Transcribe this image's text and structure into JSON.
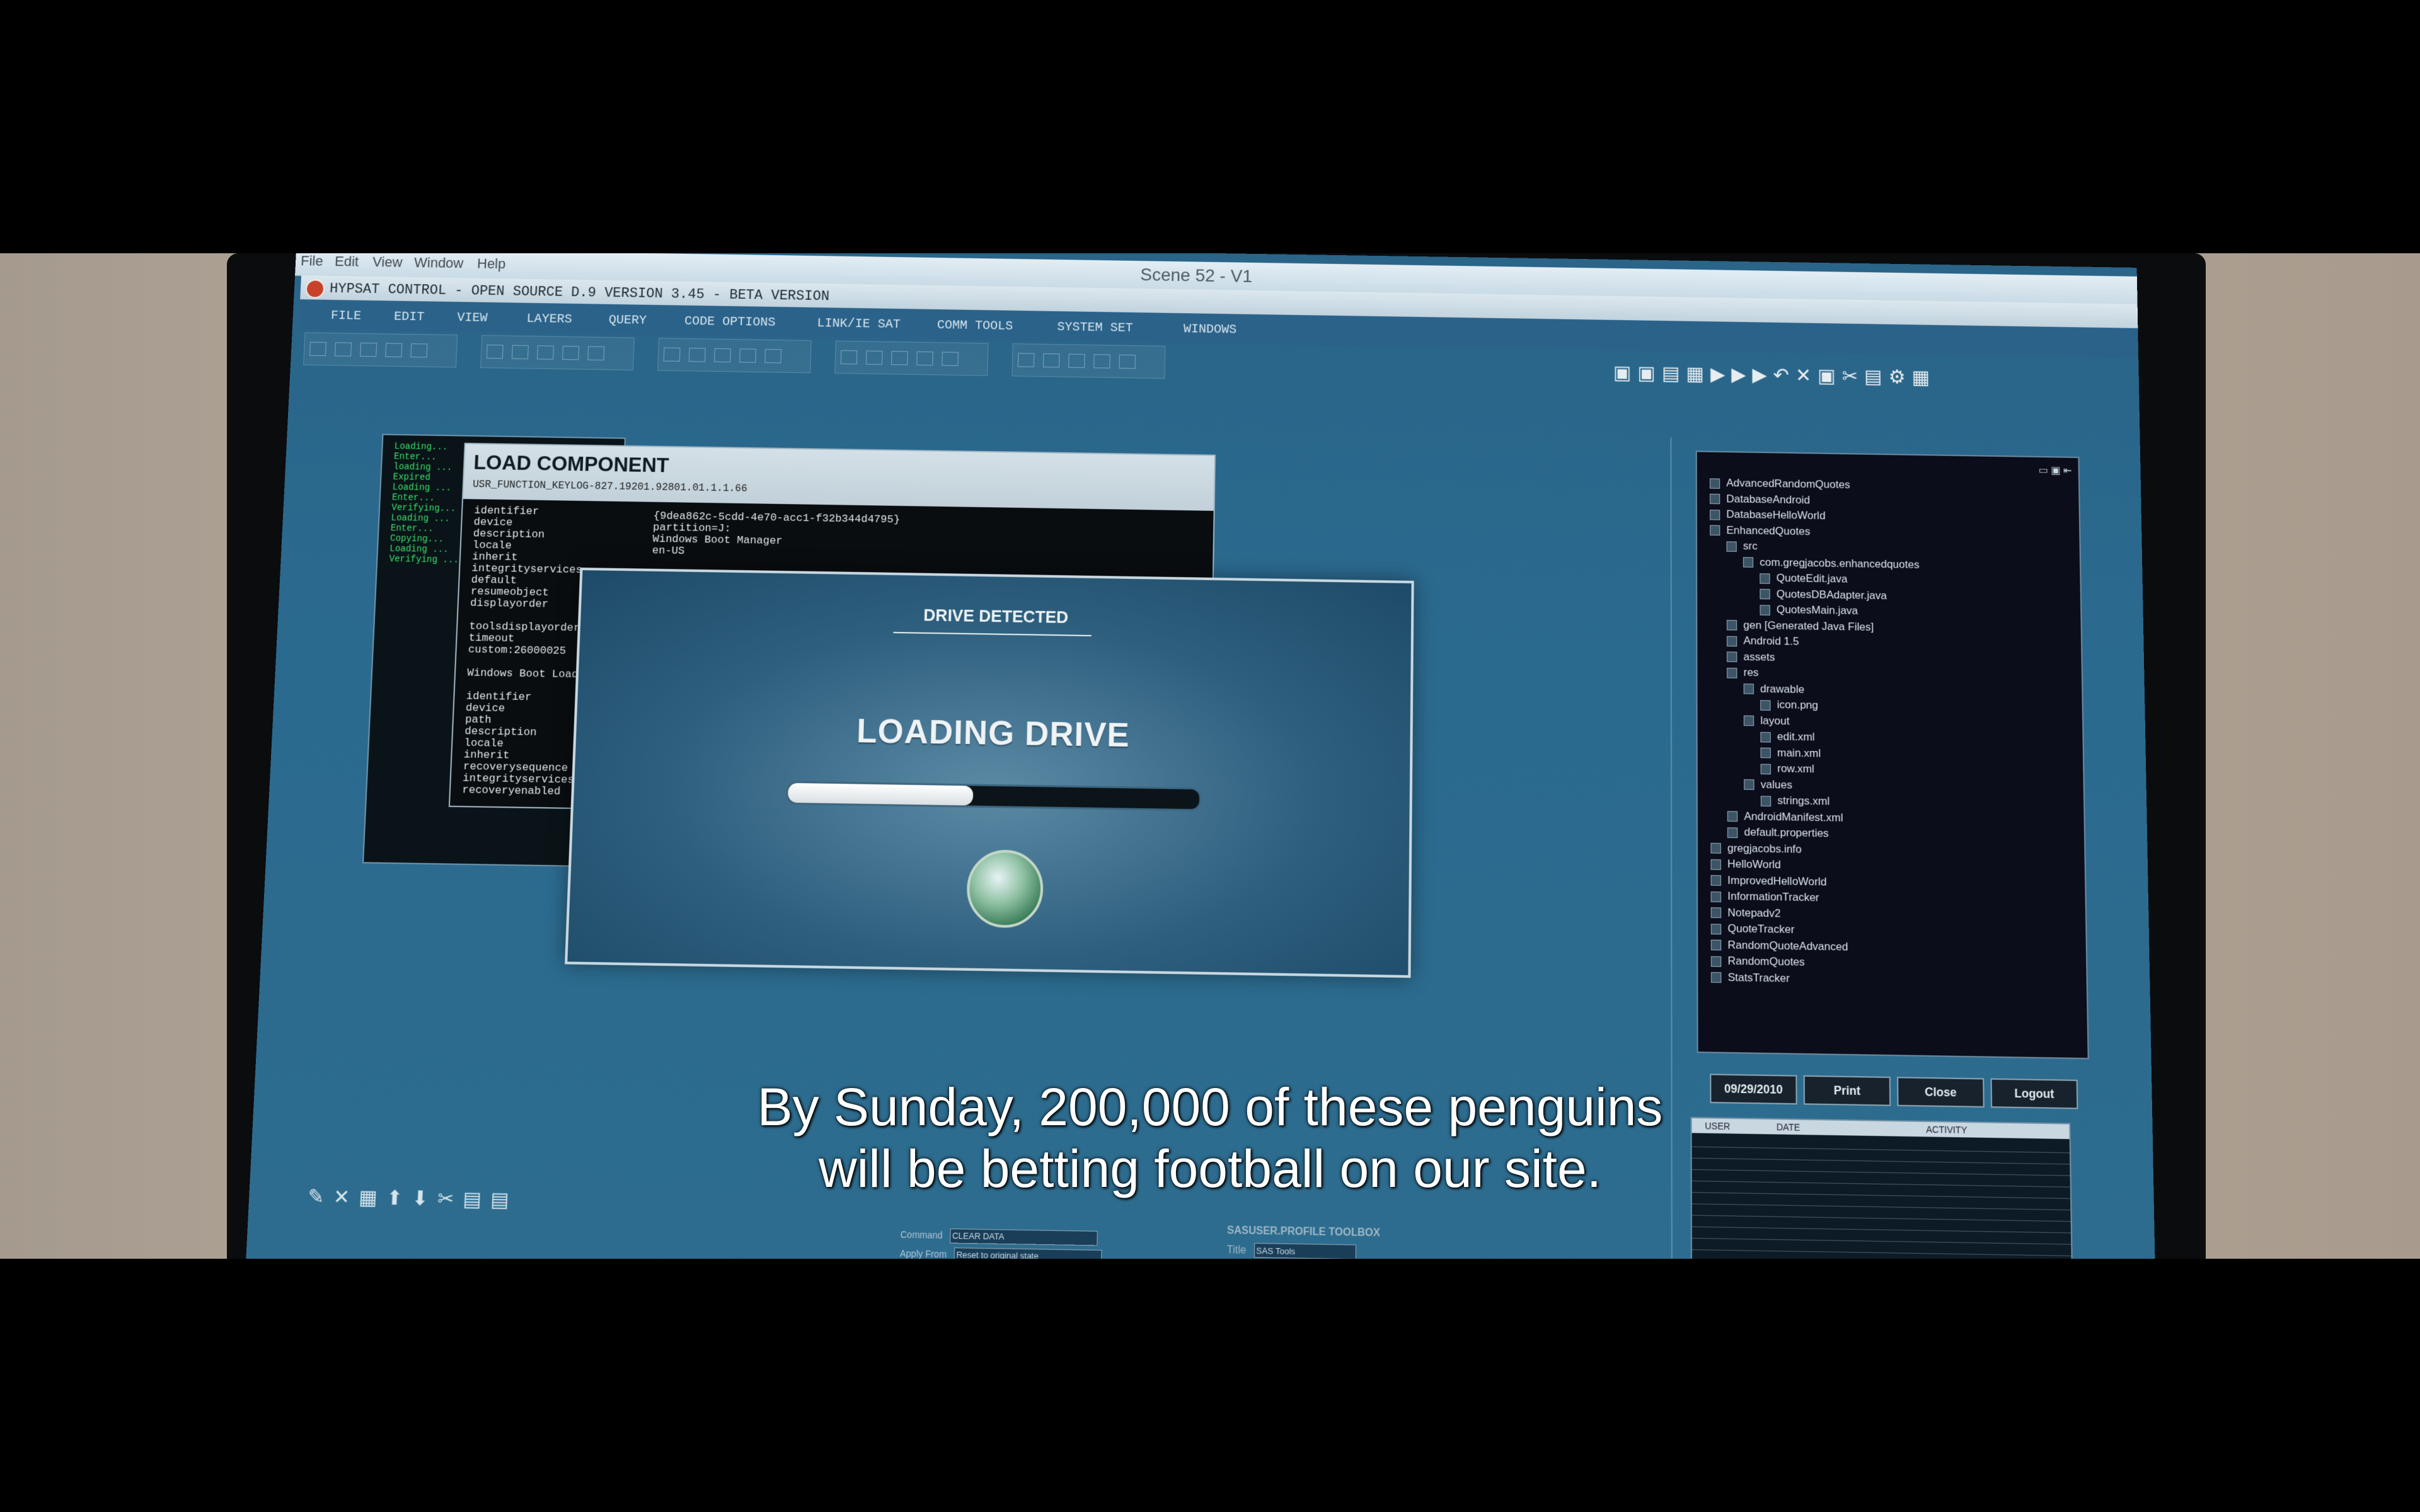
{
  "os": {
    "menu": [
      "File",
      "Edit",
      "View",
      "Window",
      "Help"
    ],
    "window_title": "Scene 52 - V1"
  },
  "app": {
    "title": "HYPSAT CONTROL - OPEN SOURCE D.9 VERSION 3.45 - BETA VERSION",
    "menu": [
      "FILE",
      "EDIT",
      "VIEW",
      "LAYERS",
      "QUERY",
      "CODE OPTIONS",
      "LINK/IE SAT",
      "COMM TOOLS",
      "SYSTEM SET",
      "WINDOWS"
    ]
  },
  "load_component": {
    "title": "LOAD COMPONENT",
    "subtitle": "USR_FUNCTION_KEYLOG-827.19201.92801.01.1.1.66",
    "fields": "identifier\ndevice\ndescription\nlocale\ninherit\nintegrityservices\ndefault\nresumeobject\ndisplayorder\n\ntoolsdisplayorder\ntimeout\ncustom:26000025\n\nWindows Boot Loader\n\nidentifier\ndevice\npath\ndescription\nlocale\ninherit\nrecoverysequence\nintegrityservices\nrecoveryenabled",
    "values": "{9dea862c-5cdd-4e70-acc1-f32b344d4795}\npartition=J:\nWindows Boot Manager\nen-US"
  },
  "console": {
    "text": "Loading...\nEnter...\nloading ...\nExpired\nLoading ...\nEnter...\nVerifying...\nLoading ...\nEnter...\nCopying...\nLoading ...\nVerifying ..."
  },
  "drive_dialog": {
    "heading": "DRIVE DETECTED",
    "status": "LOADING DRIVE",
    "progress": 0.45
  },
  "project_tree": [
    {
      "label": "AdvancedRandomQuotes",
      "level": 0
    },
    {
      "label": "DatabaseAndroid",
      "level": 0
    },
    {
      "label": "DatabaseHelloWorld",
      "level": 0
    },
    {
      "label": "EnhancedQuotes",
      "level": 0
    },
    {
      "label": "src",
      "level": 1
    },
    {
      "label": "com.gregjacobs.enhancedquotes",
      "level": 2
    },
    {
      "label": "QuoteEdit.java",
      "level": 3
    },
    {
      "label": "QuotesDBAdapter.java",
      "level": 3
    },
    {
      "label": "QuotesMain.java",
      "level": 3
    },
    {
      "label": "gen [Generated Java Files]",
      "level": 1
    },
    {
      "label": "Android 1.5",
      "level": 1
    },
    {
      "label": "assets",
      "level": 1
    },
    {
      "label": "res",
      "level": 1
    },
    {
      "label": "drawable",
      "level": 2
    },
    {
      "label": "icon.png",
      "level": 3
    },
    {
      "label": "layout",
      "level": 2
    },
    {
      "label": "edit.xml",
      "level": 3
    },
    {
      "label": "main.xml",
      "level": 3
    },
    {
      "label": "row.xml",
      "level": 3
    },
    {
      "label": "values",
      "level": 2
    },
    {
      "label": "strings.xml",
      "level": 3
    },
    {
      "label": "AndroidManifest.xml",
      "level": 1
    },
    {
      "label": "default.properties",
      "level": 1
    },
    {
      "label": "gregjacobs.info",
      "level": 0
    },
    {
      "label": "HelloWorld",
      "level": 0
    },
    {
      "label": "ImprovedHelloWorld",
      "level": 0
    },
    {
      "label": "InformationTracker",
      "level": 0
    },
    {
      "label": "Notepadv2",
      "level": 0
    },
    {
      "label": "QuoteTracker",
      "level": 0
    },
    {
      "label": "RandomQuoteAdvanced",
      "level": 0
    },
    {
      "label": "RandomQuotes",
      "level": 0
    },
    {
      "label": "StatsTracker",
      "level": 0
    }
  ],
  "bottom_panel": {
    "date": "09/29/2010",
    "buttons": [
      "Print",
      "Close",
      "Logout"
    ],
    "log_headers": [
      "USER",
      "DATE",
      "ACTIVITY"
    ]
  },
  "bottom_fields": {
    "command_label": "Command",
    "command_value": "CLEAR DATA",
    "apply_label": "Apply From",
    "apply_value": "Reset to original state",
    "toolbox": "SASUSER.PROFILE TOOLBOX",
    "title_label": "Title",
    "title_value": "SAS Tools"
  },
  "subtitles": [
    "By Sunday, 200,000 of these penguins",
    "will be betting football on our site."
  ]
}
